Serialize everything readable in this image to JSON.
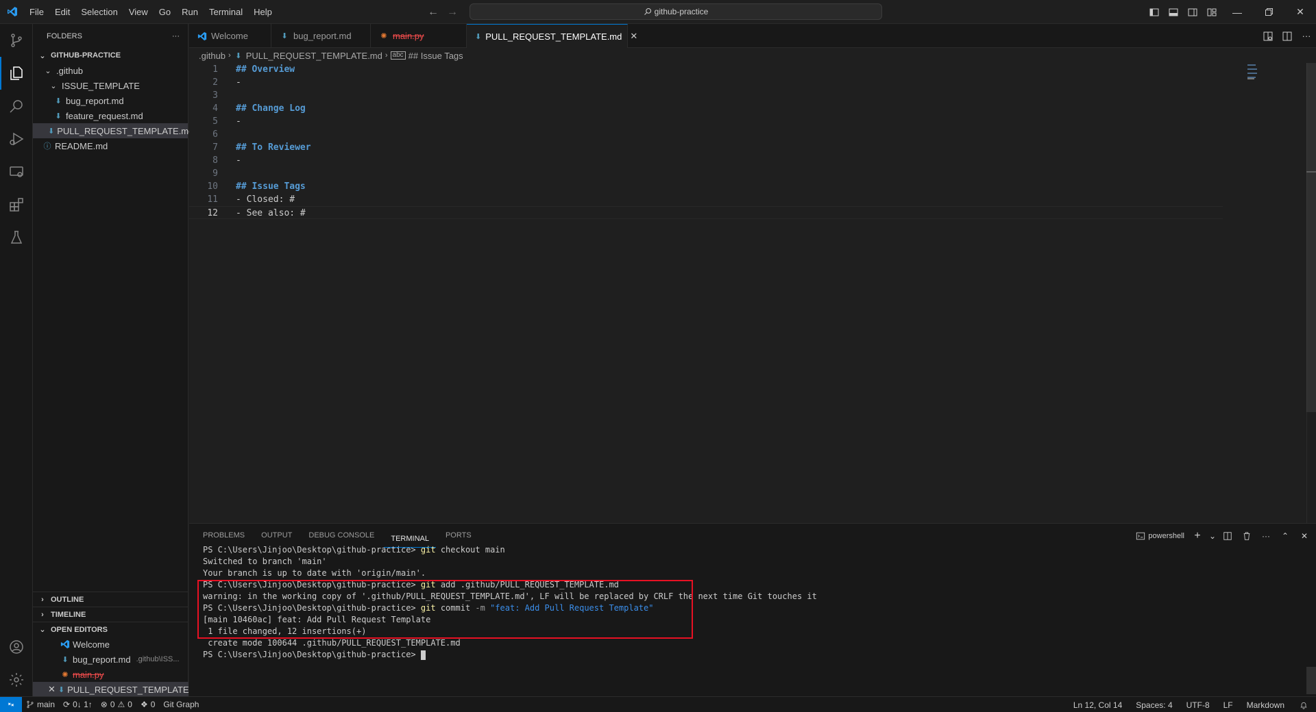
{
  "menu": [
    "File",
    "Edit",
    "Selection",
    "View",
    "Go",
    "Run",
    "Terminal",
    "Help"
  ],
  "search": {
    "label": "github-practice"
  },
  "explorer": {
    "header": "FOLDERS",
    "root": "GITHUB-PRACTICE",
    "items": [
      {
        "label": ".github"
      },
      {
        "label": "ISSUE_TEMPLATE"
      },
      {
        "label": "bug_report.md"
      },
      {
        "label": "feature_request.md"
      },
      {
        "label": "PULL_REQUEST_TEMPLATE.md"
      },
      {
        "label": "README.md"
      }
    ],
    "outline": "OUTLINE",
    "timeline": "TIMELINE",
    "open_editors": "OPEN EDITORS",
    "open_items": [
      {
        "label": "Welcome",
        "desc": ""
      },
      {
        "label": "bug_report.md",
        "desc": ".github\\ISS..."
      },
      {
        "label": "main.py",
        "desc": ""
      },
      {
        "label": "PULL_REQUEST_TEMPLATE...",
        "desc": ""
      }
    ]
  },
  "tabs": [
    {
      "label": "Welcome"
    },
    {
      "label": "bug_report.md"
    },
    {
      "label": "main.py"
    },
    {
      "label": "PULL_REQUEST_TEMPLATE.md"
    }
  ],
  "breadcrumb": [
    ".github",
    "PULL_REQUEST_TEMPLATE.md",
    "## Issue Tags"
  ],
  "editor": {
    "lines": [
      {
        "n": "1",
        "text": "## Overview"
      },
      {
        "n": "2",
        "text": "-"
      },
      {
        "n": "3",
        "text": ""
      },
      {
        "n": "4",
        "text": "## Change Log"
      },
      {
        "n": "5",
        "text": "-"
      },
      {
        "n": "6",
        "text": ""
      },
      {
        "n": "7",
        "text": "## To Reviewer"
      },
      {
        "n": "8",
        "text": "-"
      },
      {
        "n": "9",
        "text": ""
      },
      {
        "n": "10",
        "text": "## Issue Tags"
      },
      {
        "n": "11",
        "text": "- Closed: #"
      },
      {
        "n": "12",
        "text": "- See also: #"
      }
    ]
  },
  "panel": {
    "tabs": [
      "PROBLEMS",
      "OUTPUT",
      "DEBUG CONSOLE",
      "TERMINAL",
      "PORTS"
    ],
    "shell": "powershell",
    "prompt": "PS C:\\Users\\Jinjoo\\Desktop\\github-practice>",
    "t1_cmd": "git",
    "t1_rest": " checkout main",
    "t2": "Switched to branch 'main'",
    "t3": "Your branch is up to date with 'origin/main'.",
    "t4_cmd": "git",
    "t4_rest": " add .github/PULL_REQUEST_TEMPLATE.md",
    "t5": "warning: in the working copy of '.github/PULL_REQUEST_TEMPLATE.md', LF will be replaced by CRLF the next time Git touches it",
    "t6_cmd": "git",
    "t6_rest": " commit ",
    "t6_flag": "-m",
    "t6_str": " \"feat: Add Pull Request Template\"",
    "t7": "[main 10460ac] feat: Add Pull Request Template",
    "t8": " 1 file changed, 12 insertions(+)",
    "t9": " create mode 100644 .github/PULL_REQUEST_TEMPLATE.md"
  },
  "status": {
    "branch": "main",
    "sync": "0↓ 1↑",
    "errors": "0",
    "warnings": "0",
    "ports": "0",
    "git_graph": "Git Graph",
    "position": "Ln 12, Col 14",
    "spaces": "Spaces: 4",
    "encoding": "UTF-8",
    "eol": "LF",
    "language": "Markdown"
  },
  "colors": {
    "accent": "#0078d4",
    "header": "#569cd6",
    "highlight_box": "#e81123"
  }
}
